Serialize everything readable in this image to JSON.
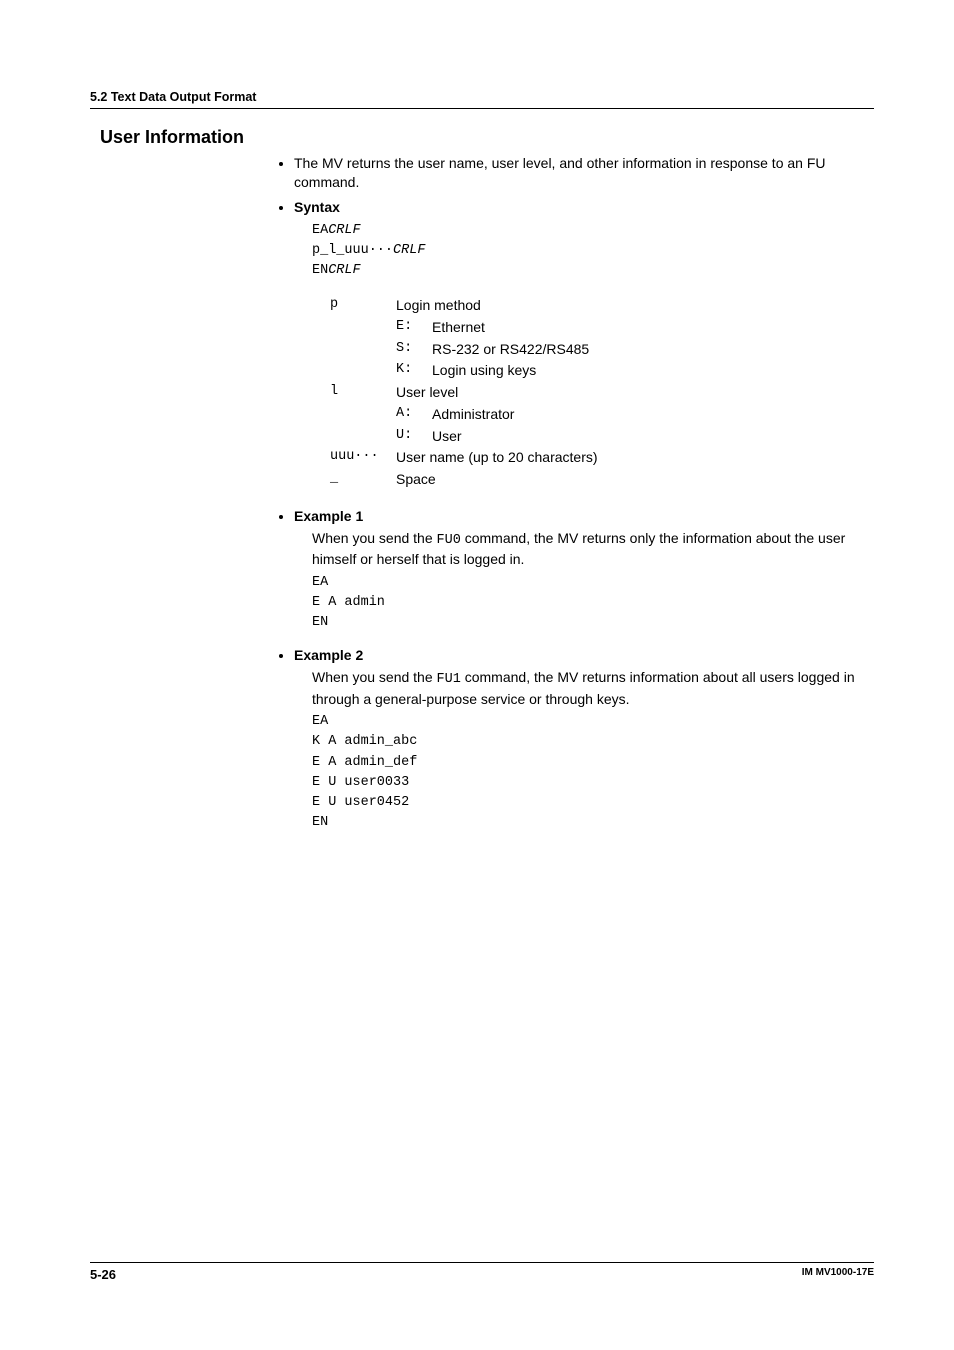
{
  "header": {
    "section_label": "5.2  Text Data Output Format"
  },
  "title": "User Information",
  "intro_bullet": "The MV returns the user name, user level, and other information in response to an FU command.",
  "syntax": {
    "heading": "Syntax",
    "lines_plain": [
      "EA",
      "p_l_uuu···",
      "EN"
    ],
    "crlf": "CRLF",
    "params": [
      {
        "sym": "p",
        "desc": "Login method",
        "sub": [
          {
            "sym": "E:",
            "desc": "Ethernet"
          },
          {
            "sym": "S:",
            "desc": "RS-232 or RS422/RS485"
          },
          {
            "sym": "K:",
            "desc": "Login using keys"
          }
        ]
      },
      {
        "sym": "l",
        "desc": "User level",
        "sub": [
          {
            "sym": "A:",
            "desc": "Administrator"
          },
          {
            "sym": "U:",
            "desc": "User"
          }
        ]
      },
      {
        "sym": "uuu···",
        "desc": "User name (up to 20 characters)",
        "sub": []
      },
      {
        "sym": "_",
        "desc": "Space",
        "sub": []
      }
    ]
  },
  "example1": {
    "heading": "Example 1",
    "text_pre": "When you send the ",
    "cmd": "FU0",
    "text_post": " command, the MV returns only the information about the user himself or herself that is logged in.",
    "lines": [
      "EA",
      "E A admin",
      "EN"
    ]
  },
  "example2": {
    "heading": "Example 2",
    "text_pre": "When you send the ",
    "cmd": "FU1",
    "text_post": " command, the MV returns information about all users logged in through a general-purpose service or through keys.",
    "lines": [
      "EA",
      "K A admin_abc",
      "E A admin_def",
      "E U user0033",
      "E U user0452",
      "EN"
    ]
  },
  "footer": {
    "page": "5-26",
    "docid": "IM MV1000-17E"
  }
}
